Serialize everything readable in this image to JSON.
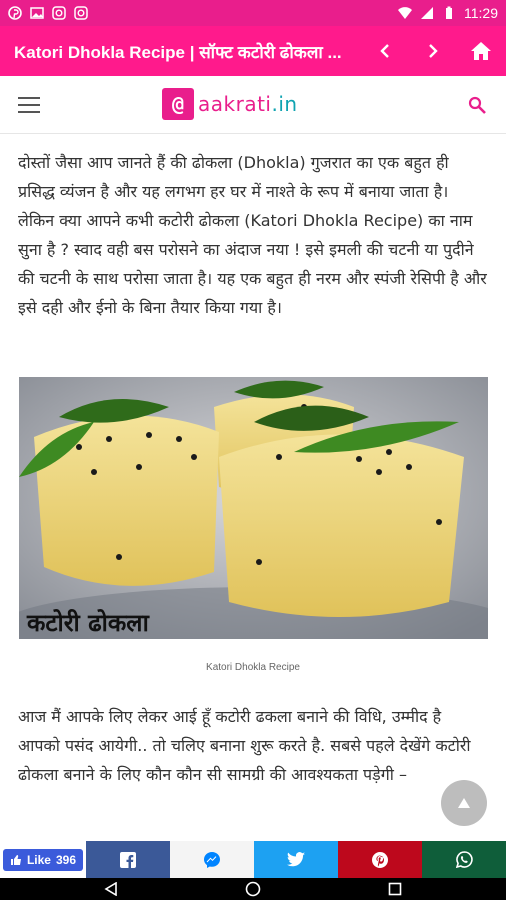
{
  "status_bar": {
    "time": "11:29",
    "battery_icon": "battery-icon",
    "wifi_icon": "wifi-icon"
  },
  "app_bar": {
    "title": "Katori Dhokla Recipe | सॉफ्ट कटोरी ढोकला ..."
  },
  "site": {
    "logo_symbol": "@",
    "logo_name": "aakrati",
    "logo_tld": ".in"
  },
  "article": {
    "intro": "दोस्तों जैसा आप जानते हैं की  ढोकला (Dhokla) गुजरात का एक बहुत ही प्रसिद्ध व्यंजन है और यह लगभग हर घर में नाश्ते के रूप में बनाया जाता है। लेकिन क्या आपने कभी कटोरी ढोकला (Katori Dhokla Recipe) का नाम सुना है ? स्वाद वही बस परोसने का अंदाज नया ! इसे इमली की चटनी या पुदीने की चटनी के साथ परोसा जाता है। यह एक बहुत ही नरम और स्पंजी रेसिपी है और इसे दही और ईनो के बिना तैयार किया गया है।",
    "image_overlay_text": "कटोरी ढोकला",
    "image_caption": "Katori Dhokla Recipe",
    "body": "आज मैं आपके लिए लेकर आई हूँ कटोरी ढकला बनाने की विधि, उम्मीद है आपको पसंद आयेगी.. तो चलिए बनाना शुरू करते है. सबसे पहले देखेंगे कटोरी ढोकला बनाने के लिए कौन कौन सी सामग्री की आवश्यकता पड़ेगी –"
  },
  "share": {
    "like_label": "Like",
    "like_count": "396"
  },
  "colors": {
    "brand_pink": "#ff1a8c",
    "logo_teal": "#0fa3b1"
  }
}
